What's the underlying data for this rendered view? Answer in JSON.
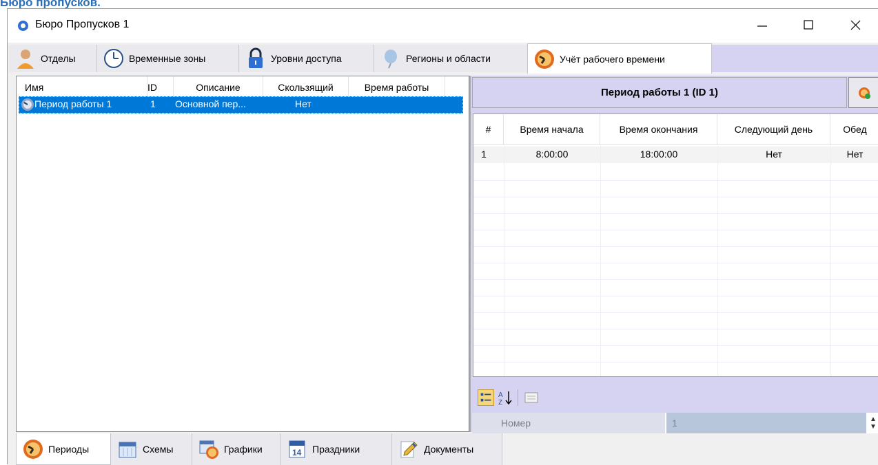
{
  "page_heading": "Бюро пропусков.",
  "window": {
    "title": "Бюро Пропусков 1"
  },
  "top_tabs": [
    {
      "label": "Отделы",
      "icon": "person-icon"
    },
    {
      "label": "Временные зоны",
      "icon": "clock-icon"
    },
    {
      "label": "Уровни доступа",
      "icon": "padlock-icon"
    },
    {
      "label": "Регионы и области",
      "icon": "balloon-icon"
    },
    {
      "label": "Учёт рабочего времени",
      "icon": "time-tracking-icon",
      "active": true
    }
  ],
  "left_list": {
    "columns": [
      "Имя",
      "ID",
      "Описание",
      "Скользящий",
      "Время работы"
    ],
    "rows": [
      {
        "name": "Период работы 1",
        "id": "1",
        "description": "Основной пер...",
        "sliding": "Нет",
        "work_time": ""
      }
    ]
  },
  "period_panel": {
    "title": "Период работы 1 (ID 1)",
    "columns": [
      "#",
      "Время начала",
      "Время окончания",
      "Следующий день",
      "Обед"
    ],
    "rows": [
      {
        "num": "1",
        "start": "8:00:00",
        "end": "18:00:00",
        "next_day": "Нет",
        "lunch": "Нет"
      }
    ]
  },
  "properties": {
    "rows": [
      {
        "name": "Номер",
        "value": "1"
      }
    ]
  },
  "bottom_tabs": [
    {
      "label": "Периоды",
      "icon": "periods-icon",
      "active": true
    },
    {
      "label": "Схемы",
      "icon": "calendar-icon"
    },
    {
      "label": "Графики",
      "icon": "schedule-icon"
    },
    {
      "label": "Праздники",
      "icon": "holiday-calendar-icon"
    },
    {
      "label": "Документы",
      "icon": "document-pencil-icon"
    }
  ],
  "colors": {
    "accent_panel": "#d6d3f2",
    "selection": "#0078d7"
  }
}
